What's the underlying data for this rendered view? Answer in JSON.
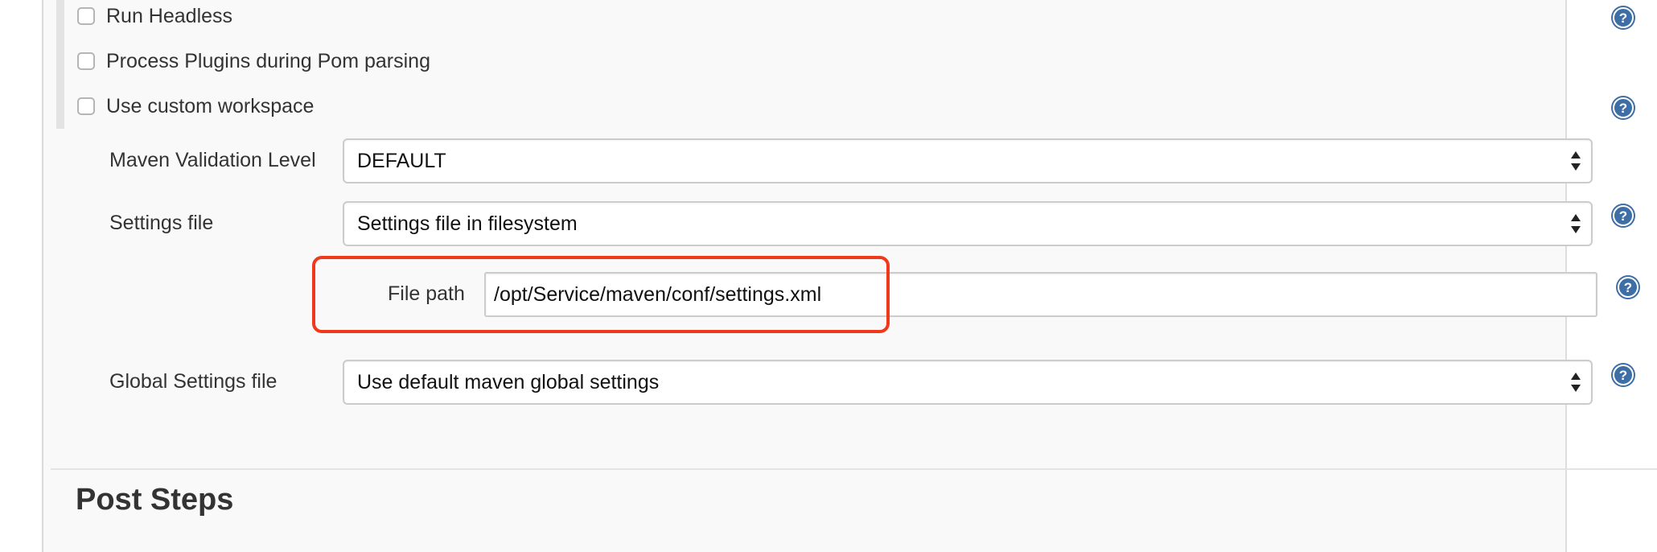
{
  "checkboxes": [
    {
      "label": "Run Headless",
      "checked": false
    },
    {
      "label": "Process Plugins during Pom parsing",
      "checked": false
    },
    {
      "label": "Use custom workspace",
      "checked": false
    }
  ],
  "fields": {
    "validation_level": {
      "label": "Maven Validation Level",
      "value": "DEFAULT"
    },
    "settings_file": {
      "label": "Settings file",
      "value": "Settings file in filesystem"
    },
    "file_path": {
      "label": "File path",
      "value": "/opt/Service/maven/conf/settings.xml"
    },
    "global_settings_file": {
      "label": "Global Settings file",
      "value": "Use default maven global settings"
    }
  },
  "sections": {
    "post_steps": "Post Steps"
  },
  "icons": {
    "help": "help-icon",
    "select_arrows": "chevron-updown-icon"
  },
  "colors": {
    "highlight": "#f0391c",
    "help_icon": "#3e6ea6",
    "panel_bg": "#f9f9f9"
  }
}
